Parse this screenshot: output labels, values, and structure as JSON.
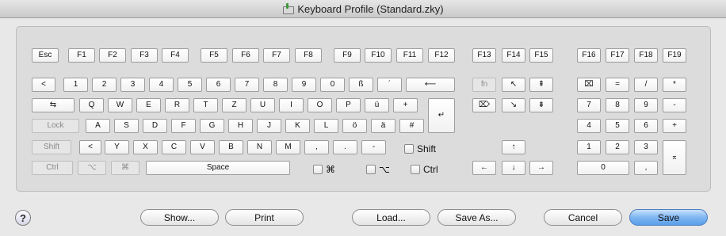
{
  "window": {
    "title": "Keyboard Profile (Standard.zky)"
  },
  "keys": {
    "esc": "Esc",
    "f1": "F1",
    "f2": "F2",
    "f3": "F3",
    "f4": "F4",
    "f5": "F5",
    "f6": "F6",
    "f7": "F7",
    "f8": "F8",
    "f9": "F9",
    "f10": "F10",
    "f11": "F11",
    "f12": "F12",
    "f13": "F13",
    "f14": "F14",
    "f15": "F15",
    "f16": "F16",
    "f17": "F17",
    "f18": "F18",
    "f19": "F19",
    "caret": "<",
    "d1": "1",
    "d2": "2",
    "d3": "3",
    "d4": "4",
    "d5": "5",
    "d6": "6",
    "d7": "7",
    "d8": "8",
    "d9": "9",
    "d0": "0",
    "sz": "ß",
    "acute": "´",
    "backspace": "⟵",
    "tab": "⇆",
    "q": "Q",
    "w": "W",
    "e": "E",
    "r": "R",
    "t": "T",
    "z": "Z",
    "u": "U",
    "i": "I",
    "o": "O",
    "p": "P",
    "ue": "ü",
    "plus": "+",
    "lock": "Lock",
    "a": "A",
    "s": "S",
    "d": "D",
    "f": "F",
    "g": "G",
    "h": "H",
    "j": "J",
    "k": "K",
    "l": "L",
    "oe": "ö",
    "ae": "ä",
    "hash": "#",
    "shift_l": "Shift",
    "lt": "<",
    "y": "Y",
    "x": "X",
    "c": "C",
    "v": "V",
    "b": "B",
    "n": "N",
    "m": "M",
    "comma": ",",
    "period": ".",
    "minus": "-",
    "ctrl": "Ctrl",
    "option": "⌥",
    "command": "⌘",
    "space": "Space",
    "return": "↵",
    "fn": "fn",
    "home": "↖",
    "page_up": "⇞",
    "delete": "⌦",
    "end": "↘",
    "page_down": "⇟",
    "up": "↑",
    "left": "←",
    "down": "↓",
    "right": "→",
    "clear": "⌧",
    "kp_equal": "=",
    "kp_divide": "/",
    "kp_multiply": "*",
    "kp7": "7",
    "kp8": "8",
    "kp9": "9",
    "kp_minus": "-",
    "kp4": "4",
    "kp5": "5",
    "kp6": "6",
    "kp_plus": "+",
    "kp1": "1",
    "kp2": "2",
    "kp3": "3",
    "kp_enter": "⌅",
    "kp0": "0",
    "kp_comma": ","
  },
  "modifiers": {
    "shift": "Shift",
    "command": "⌘",
    "option": "⌥",
    "ctrl": "Ctrl"
  },
  "buttons": {
    "help": "?",
    "show": "Show...",
    "print": "Print",
    "load": "Load...",
    "save_as": "Save As...",
    "cancel": "Cancel",
    "save": "Save"
  }
}
